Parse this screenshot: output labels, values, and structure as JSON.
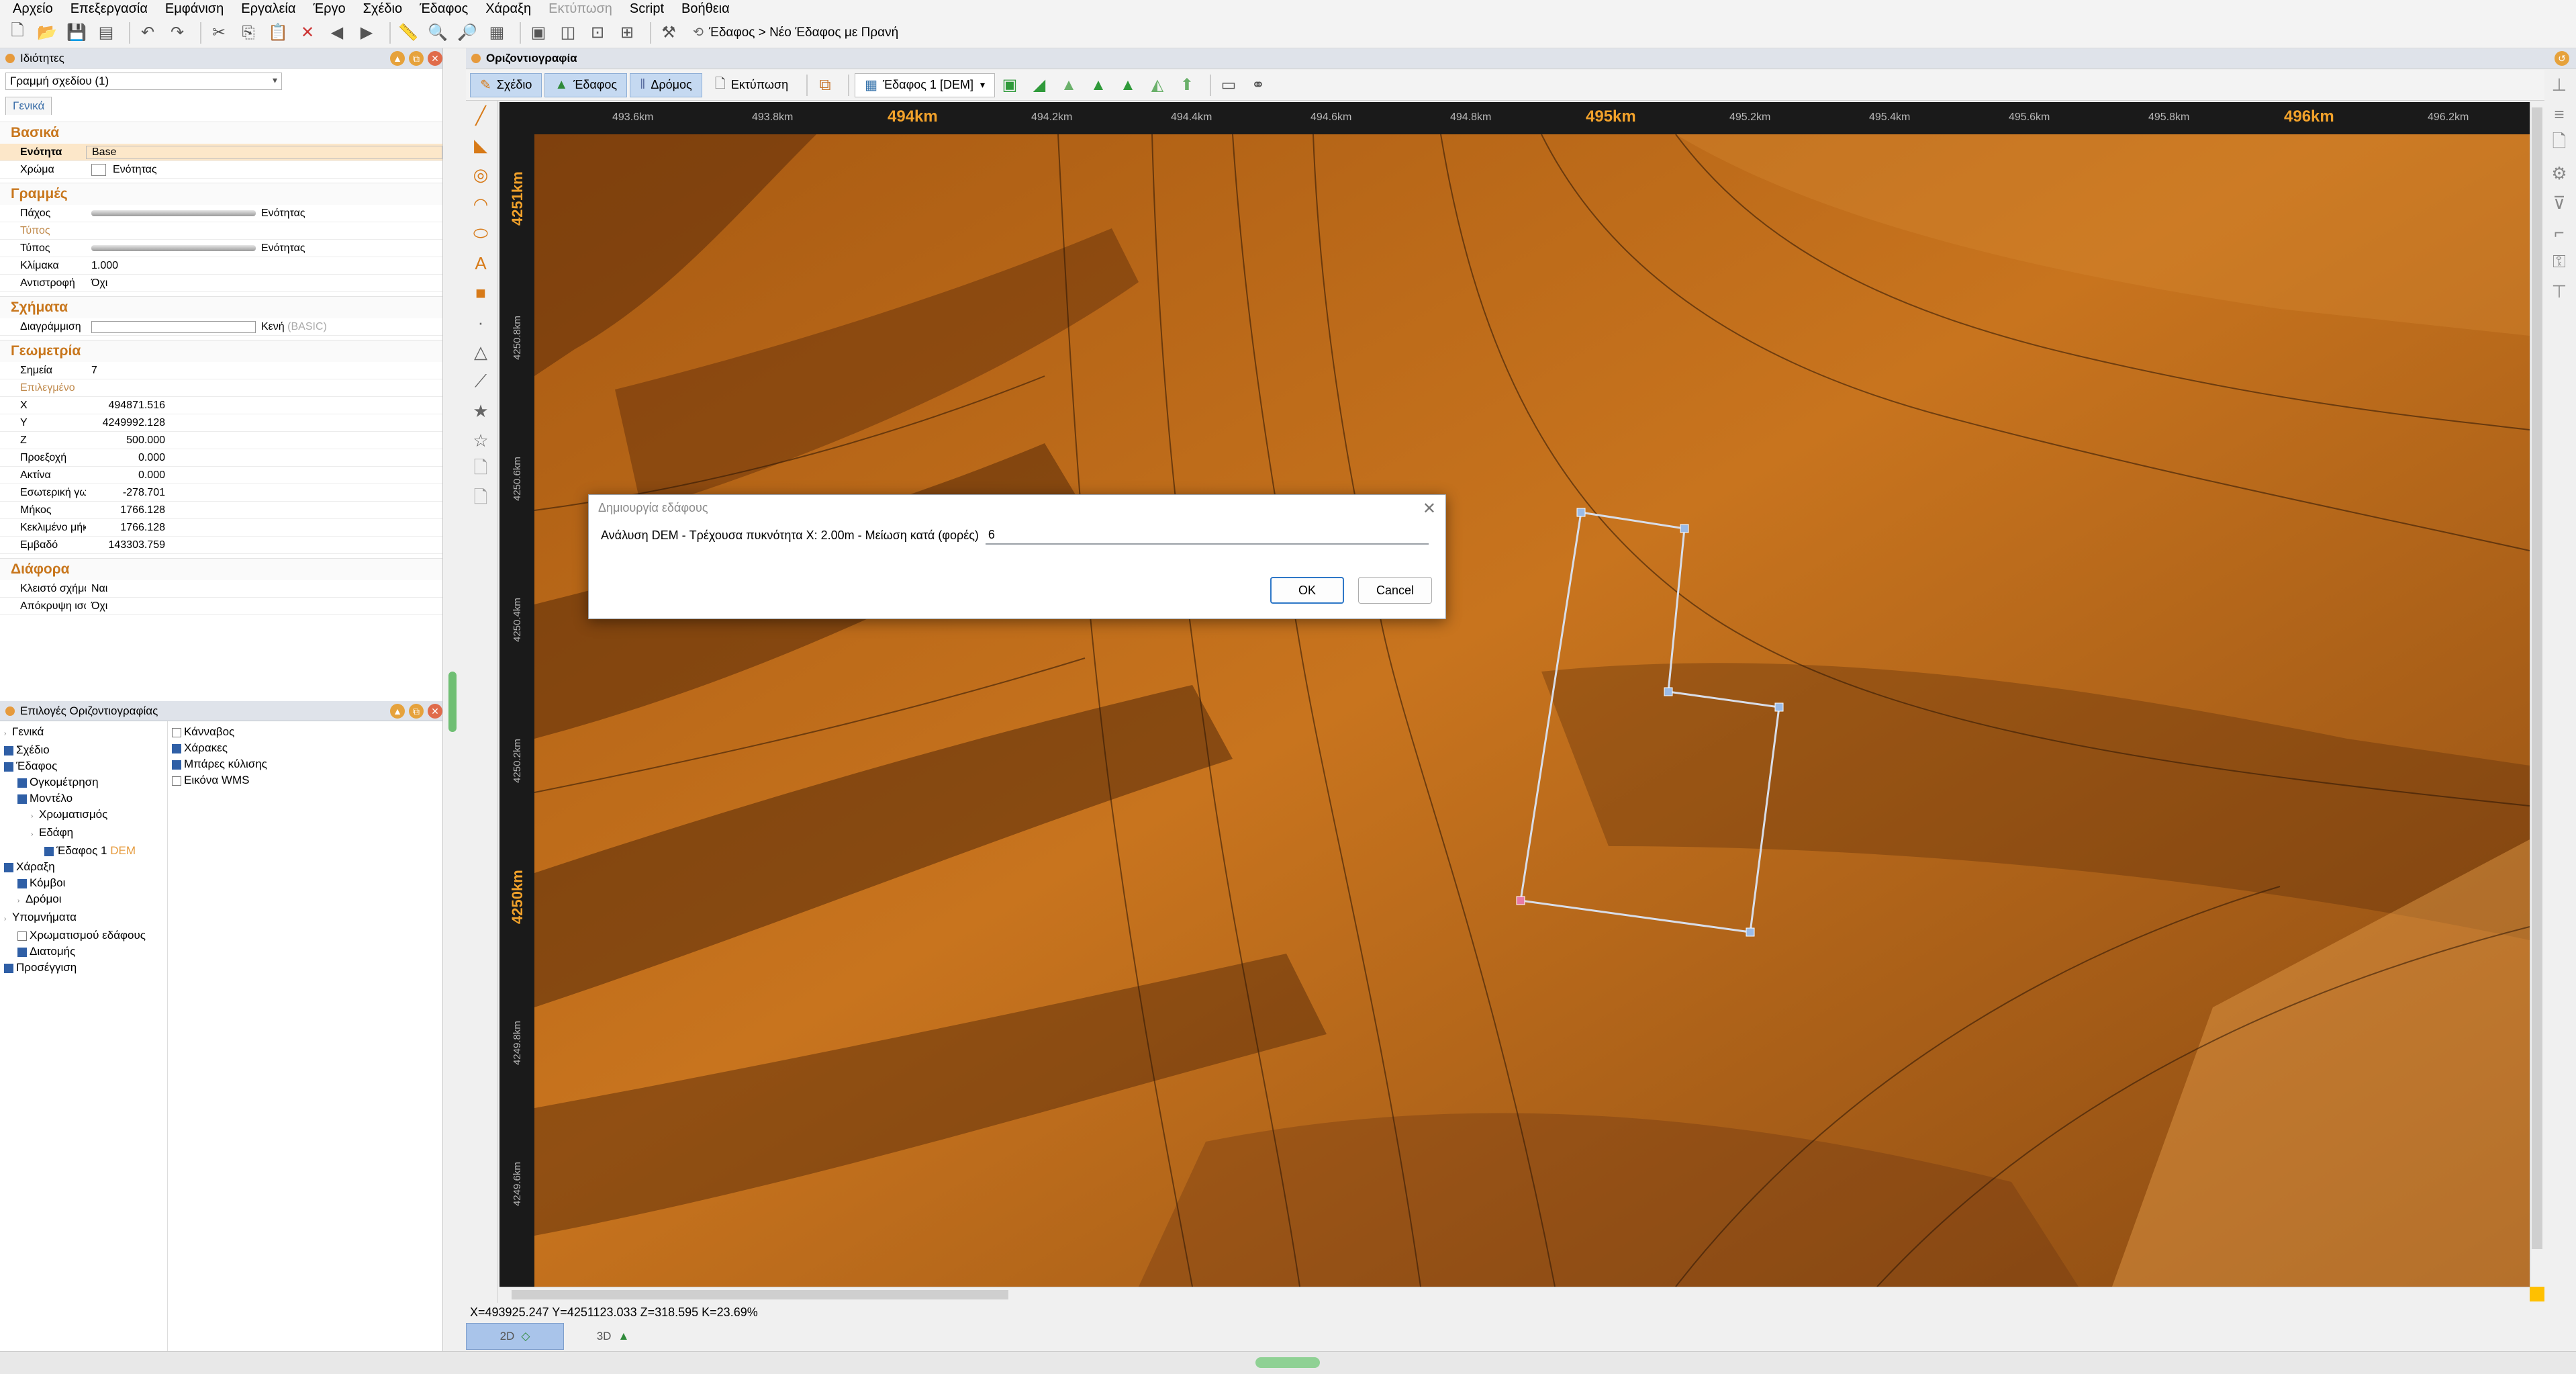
{
  "menu": [
    "Αρχείο",
    "Επεξεργασία",
    "Εμφάνιση",
    "Εργαλεία",
    "Έργο",
    "Σχέδιο",
    "Έδαφος",
    "Χάραξη",
    "Εκτύπωση",
    "Script",
    "Βοήθεια"
  ],
  "menu_disabled": "Εκτύπωση",
  "breadcrumb": "Έδαφος > Νέο Έδαφος με Πρανή",
  "props_panel": {
    "title": "Ιδιότητες",
    "selector": "Γραμμή σχεδίου (1)",
    "tab": "Γενικά",
    "basic": {
      "label": "Βασικά",
      "layer_k": "Ενότητα",
      "layer_v": "Base",
      "color_k": "Χρώμα",
      "color_v": "Ενότητας"
    },
    "lines": {
      "label": "Γραμμές",
      "thick_k": "Πάχος",
      "thick_v": "Ενότητας",
      "type_head": "Τύπος",
      "type_k": "Τύπος",
      "type_v": "Ενότητας",
      "scale_k": "Κλίμακα",
      "scale_v": "1.000",
      "rev_k": "Αντιστροφή",
      "rev_v": "Όχι"
    },
    "shapes": {
      "label": "Σχήματα",
      "hatch_k": "Διαγράμμιση",
      "hatch_v": "Κενή",
      "hatch_v2": "(BASIC)"
    },
    "geom": {
      "label": "Γεωμετρία",
      "pts_k": "Σημεία",
      "pts_v": "7",
      "selected": "Επιλεγμένο",
      "x_k": "X",
      "x_v": "494871.516",
      "y_k": "Y",
      "y_v": "4249992.128",
      "z_k": "Z",
      "z_v": "500.000",
      "proj_k": "Προεξοχή",
      "proj_v": "0.000",
      "rad_k": "Ακτίνα",
      "rad_v": "0.000",
      "int_k": "Εσωτερική γω",
      "int_v": "-278.701",
      "len_k": "Μήκος",
      "len_v": "1766.128",
      "closed_len_k": "Κεκλιμένο μήκο",
      "closed_len_v": "1766.128",
      "area_k": "Εμβαδό",
      "area_v": "143303.759"
    },
    "misc": {
      "label": "Διάφορα",
      "closed_k": "Κλειστό σχήμα",
      "closed_v": "Ναι",
      "hide_k": "Απόκρυψη ισα",
      "hide_v": "Όχι"
    }
  },
  "opts_panel": {
    "title": "Επιλογές Οριζοντιογραφίας",
    "tree": [
      {
        "label": "Γενικά",
        "check": "none",
        "indent": 0
      },
      {
        "label": "Σχέδιο",
        "check": "on",
        "indent": 0
      },
      {
        "label": "Έδαφος",
        "check": "on",
        "indent": 0
      },
      {
        "label": "Ογκομέτρηση",
        "check": "on",
        "indent": 1
      },
      {
        "label": "Μοντέλο",
        "check": "on",
        "indent": 1
      },
      {
        "label": "Χρωματισμός",
        "check": "none",
        "indent": 2
      },
      {
        "label": "Εδάφη",
        "check": "none",
        "indent": 2
      },
      {
        "label": "Έδαφος 1",
        "check": "on",
        "indent": 3,
        "tag": "DEM"
      },
      {
        "label": "Χάραξη",
        "check": "on",
        "indent": 0
      },
      {
        "label": "Κόμβοι",
        "check": "on",
        "indent": 1
      },
      {
        "label": "Δρόμοι",
        "check": "none",
        "indent": 1
      },
      {
        "label": "Υπομνήματα",
        "check": "none",
        "indent": 0
      },
      {
        "label": "Χρωματισμού εδάφους",
        "check": "off",
        "indent": 1
      },
      {
        "label": "Διατομής",
        "check": "on",
        "indent": 1
      },
      {
        "label": "Προσέγγιση",
        "check": "on",
        "indent": 0
      }
    ],
    "right": [
      {
        "label": "Κάνναβος",
        "check": "off"
      },
      {
        "label": "Χάρακες",
        "check": "on"
      },
      {
        "label": "Μπάρες κύλισης",
        "check": "on"
      },
      {
        "label": "Εικόνα WMS",
        "check": "off"
      }
    ]
  },
  "map_window": {
    "title": "Οριζοντιογραφία",
    "tabs": [
      "Σχέδιο",
      "Έδαφος",
      "Δρόμος",
      "Εκτύπωση"
    ],
    "terrain_select": "Έδαφος 1 [DEM]"
  },
  "ruler_x": [
    "493.6km",
    "493.8km",
    "494km",
    "494.2km",
    "494.4km",
    "494.6km",
    "494.8km",
    "495km",
    "495.2km",
    "495.4km",
    "495.6km",
    "495.8km",
    "496km",
    "496.2km"
  ],
  "ruler_y": [
    "4251km",
    "4250.8km",
    "4250.6km",
    "4250.4km",
    "4250.2km",
    "4250km",
    "4249.8km",
    "4249.6km"
  ],
  "status": "X=493925.247  Y=4251123.033  Z=318.595  K=23.69%",
  "view_tabs": [
    "2D",
    "3D"
  ],
  "dialog": {
    "title": "Δημιουργία εδάφους",
    "prompt": "Ανάλυση DEM - Τρέχουσα πυκνότητα X: 2.00m - Μείωση κατά (φορές)",
    "value": "6",
    "ok": "OK",
    "cancel": "Cancel"
  },
  "colors": {
    "terrain_accent": "#f2a22b",
    "panel_header": "#dfe3ea",
    "tab_active": "#c5d9f1"
  }
}
